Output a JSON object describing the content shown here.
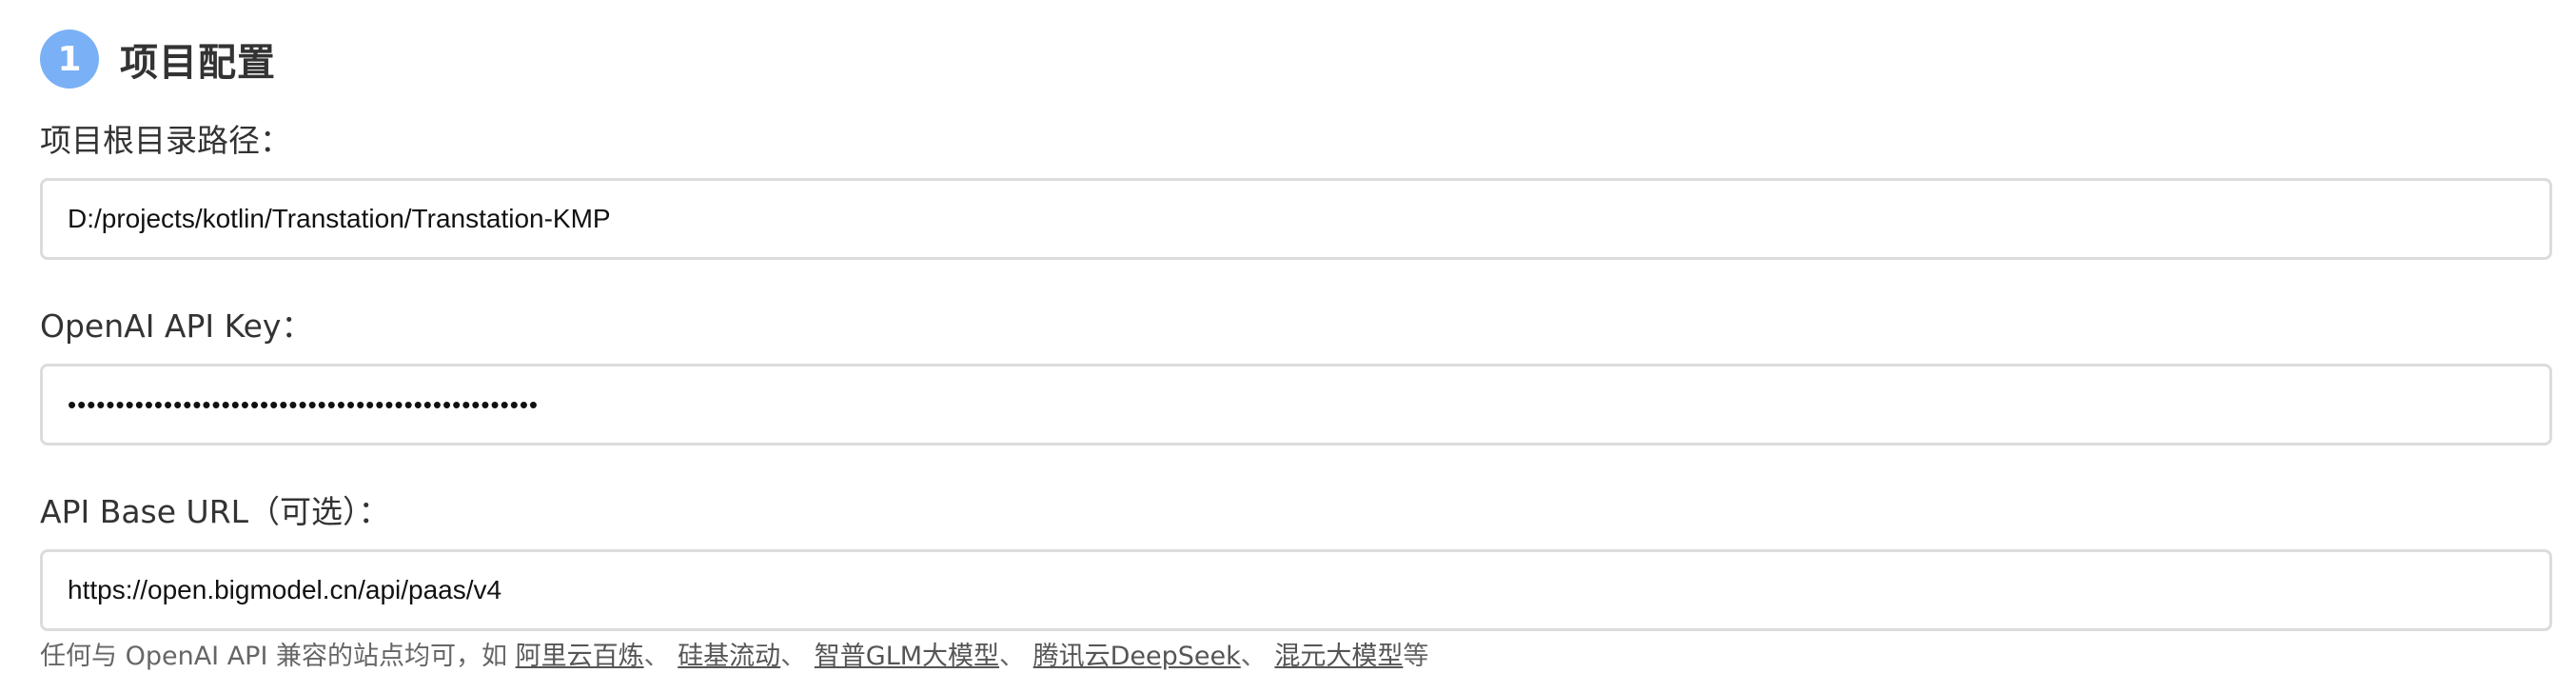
{
  "section": {
    "step_number": "1",
    "title": "项目配置"
  },
  "fields": {
    "project_root": {
      "label": "项目根目录路径：",
      "value": "D:/projects/kotlin/Transtation/Transtation-KMP"
    },
    "api_key": {
      "label": "OpenAI API Key：",
      "value": "•••••••••••••••••••••••••••••••••••••••••••••••••"
    },
    "base_url": {
      "label": "API Base URL（可选）：",
      "value": "https://open.bigmodel.cn/api/paas/v4"
    }
  },
  "hint": {
    "prefix": "任何与 OpenAI API 兼容的站点均可，如 ",
    "links": [
      "阿里云百炼",
      "硅基流动",
      "智普GLM大模型",
      "腾讯云DeepSeek",
      "混元大模型"
    ],
    "separator": "、 ",
    "suffix": "等"
  }
}
